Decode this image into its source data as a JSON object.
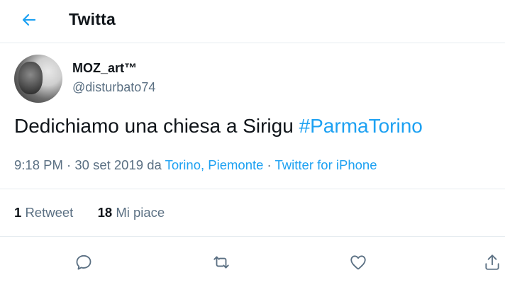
{
  "header": {
    "title": "Twitta",
    "back_icon": "arrow-left-icon"
  },
  "tweet": {
    "author": {
      "display_name": "MOZ_art™",
      "username": "@disturbato74"
    },
    "text": "Dedichiamo una chiesa a Sirigu ",
    "hashtag": "#ParmaTorino",
    "time": "9:18 PM",
    "sep1": " · ",
    "date": "30 set 2019",
    "da": " da ",
    "location": "Torino, Piemonte",
    "sep2": " · ",
    "source": "Twitter for iPhone"
  },
  "stats": {
    "retweets_count": "1",
    "retweets_label": "Retweet",
    "likes_count": "18",
    "likes_label": "Mi piace"
  },
  "actions": [
    "reply-icon",
    "retweet-icon",
    "like-icon",
    "share-icon"
  ],
  "colors": {
    "accent": "#1da1f2",
    "secondary_text": "#5b7083",
    "divider": "#e6ecf0"
  }
}
